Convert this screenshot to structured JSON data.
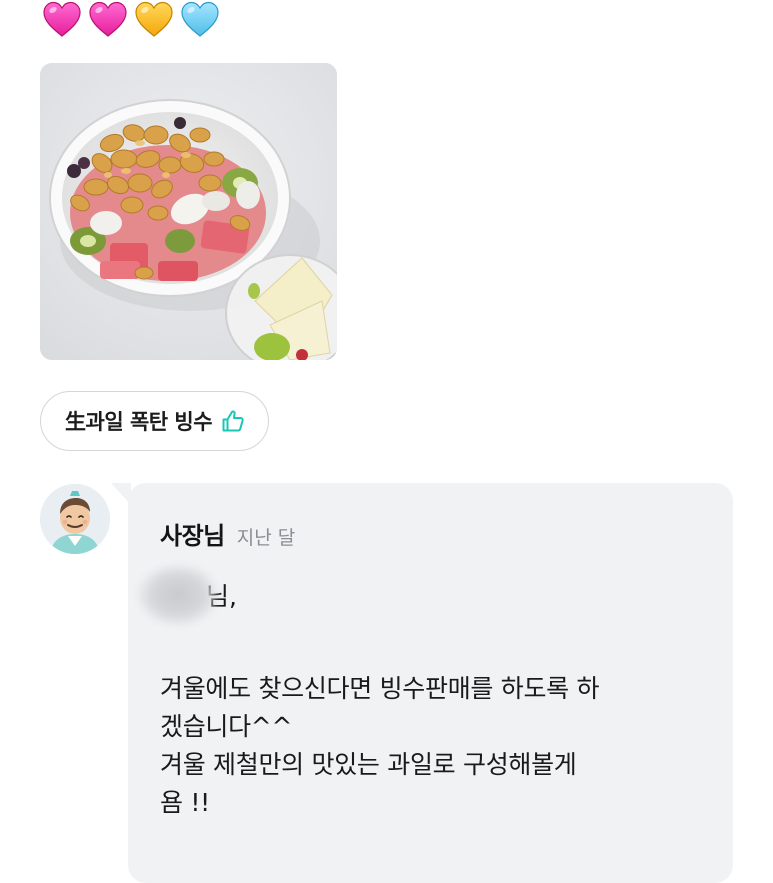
{
  "review": {
    "hearts": [
      {
        "icon": "heart-icon",
        "color": "#ff3fb8"
      },
      {
        "icon": "heart-icon",
        "color": "#ff3fb8"
      },
      {
        "icon": "heart-icon",
        "color": "#ffc02e"
      },
      {
        "icon": "heart-icon",
        "color": "#6fcdf2"
      }
    ],
    "photo": {
      "icon": "review-photo"
    },
    "menu_tag": {
      "label": "生과일 폭탄 빙수",
      "icon": "thumbs-up-icon",
      "icon_color": "#19c7b7"
    }
  },
  "owner_reply": {
    "avatar": {
      "icon": "owner-avatar"
    },
    "name": "사장님",
    "time": "지난 달",
    "greeting_suffix": "님,",
    "lines": [
      "겨울에도 찾으신다면 빙수판매를 하도록 하",
      "겠습니다^^",
      "겨울 제철만의 맛있는 과일로 구성해볼게",
      "욤 !!"
    ],
    "bubble_color": "#f1f2f4"
  }
}
